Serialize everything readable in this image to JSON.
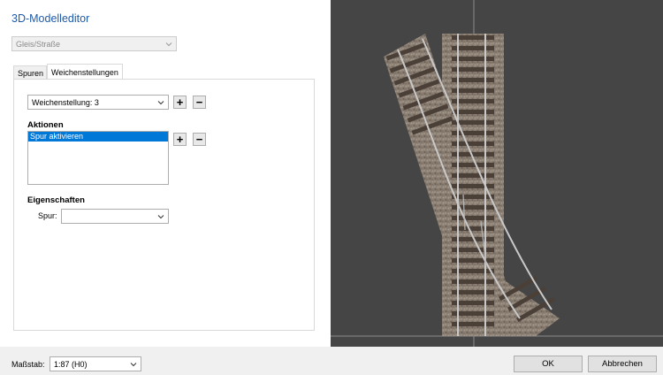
{
  "window": {
    "title": "3D-Modelleditor"
  },
  "type_select": {
    "value": "Gleis/Straße"
  },
  "tabs": [
    {
      "label": "Spuren"
    },
    {
      "label": "Weichenstellungen"
    }
  ],
  "switch_select": {
    "value": "Weichenstellung: 3"
  },
  "actions": {
    "heading": "Aktionen",
    "items": [
      "Spur aktivieren"
    ]
  },
  "properties": {
    "heading": "Eigenschaften",
    "track_label": "Spur:",
    "track_value": ""
  },
  "footer": {
    "scale_label": "Maßstab:",
    "scale_value": "1:87 (H0)",
    "ok_label": "OK",
    "cancel_label": "Abbrechen"
  },
  "icons": {
    "add": "plus-icon",
    "remove": "minus-icon",
    "dropdown": "chevron-down-icon"
  },
  "colors": {
    "title": "#1f5aa8",
    "selection": "#0078d7",
    "viewport_bg": "#454545"
  }
}
